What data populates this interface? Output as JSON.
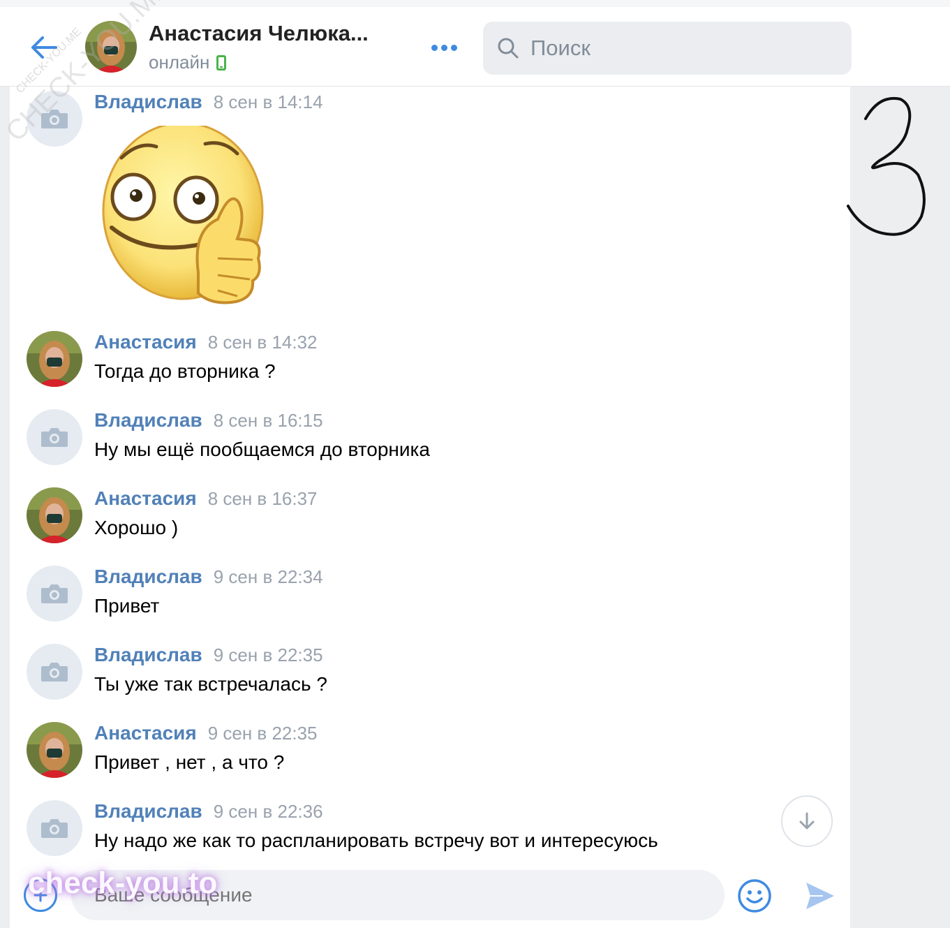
{
  "header": {
    "contact_name": "Анастасия Челюка...",
    "status": "онлайн",
    "search_placeholder": "Поиск"
  },
  "messages": [
    {
      "author": "Владислав",
      "time": "8 сен в 14:14",
      "text": "",
      "avatar": "camera-placeholder",
      "sticker": "thumbs-up-smiley"
    },
    {
      "author": "Анастасия",
      "time": "8 сен в 14:32",
      "text": "Тогда до вторника ?",
      "avatar": "photo"
    },
    {
      "author": "Владислав",
      "time": "8 сен в 16:15",
      "text": "Ну мы ещё пообщаемся до вторника",
      "avatar": "camera-placeholder"
    },
    {
      "author": "Анастасия",
      "time": "8 сен в 16:37",
      "text": "Хорошо )",
      "avatar": "photo"
    },
    {
      "author": "Владислав",
      "time": "9 сен в 22:34",
      "text": "Привет",
      "avatar": "camera-placeholder"
    },
    {
      "author": "Владислав",
      "time": "9 сен в 22:35",
      "text": "Ты уже так встречалась ?",
      "avatar": "camera-placeholder"
    },
    {
      "author": "Анастасия",
      "time": "9 сен в 22:35",
      "text": "Привет , нет , а что ?",
      "avatar": "photo"
    },
    {
      "author": "Владислав",
      "time": "9 сен в 22:36",
      "text": "Ну надо же как то распланировать встречу вот и интересуюсь",
      "avatar": "camera-placeholder"
    }
  ],
  "composer": {
    "placeholder": "Ваше сообщение"
  },
  "watermark": {
    "bottom": "check-you.to",
    "diagonal": "CHECK-YOU.ME",
    "diagonal_small": "CHECK-YOU.ME"
  },
  "handwritten_mark": "3",
  "colors": {
    "accent": "#3f8ae0",
    "author": "#5181b8",
    "muted": "#818c99",
    "online": "#4bb34b"
  }
}
